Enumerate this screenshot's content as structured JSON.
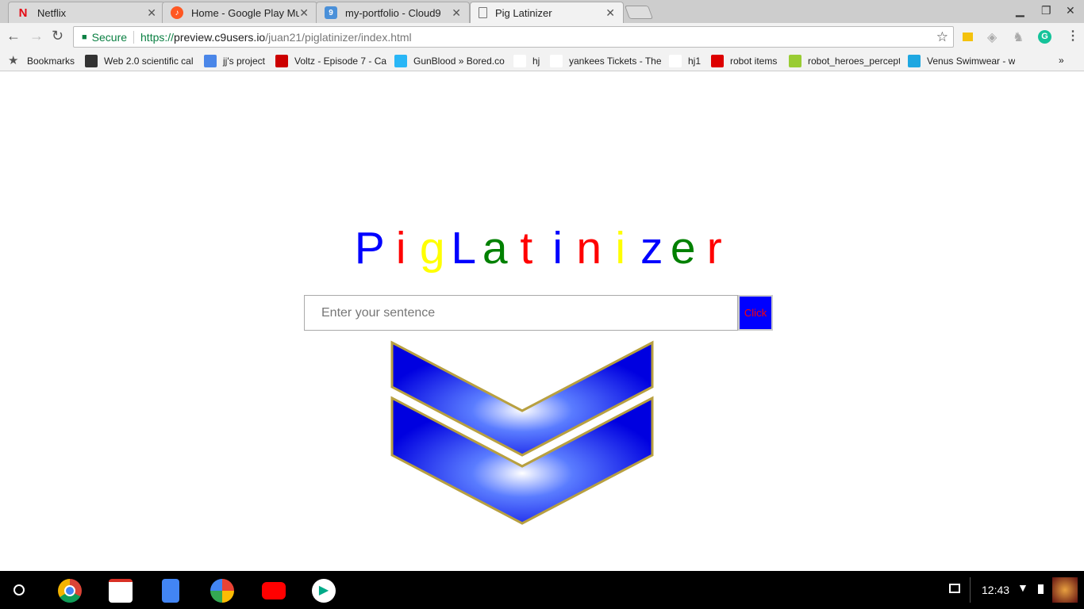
{
  "tabs": [
    {
      "title": "Netflix",
      "icon": "netflix-icon"
    },
    {
      "title": "Home - Google Play Mus",
      "icon": "play-music-icon"
    },
    {
      "title": "my-portfolio - Cloud9",
      "icon": "cloud9-icon"
    },
    {
      "title": "Pig Latinizer",
      "icon": "page-icon",
      "active": true
    }
  ],
  "address": {
    "secure_label": "Secure",
    "scheme": "https://",
    "host": "preview.c9users.io",
    "path": "/juan21/piglatinizer/index.html"
  },
  "bookmarks": [
    {
      "label": "Bookmarks",
      "color": "#555"
    },
    {
      "label": "Web 2.0 scientific cal",
      "color": "#333"
    },
    {
      "label": "jj's project",
      "color": "#4a86e8"
    },
    {
      "label": "Voltz - Episode 7 - Ca",
      "color": "#c00"
    },
    {
      "label": "GunBlood » Bored.co",
      "color": "#29b6f6"
    },
    {
      "label": "hj",
      "color": "#fff"
    },
    {
      "label": "yankees Tickets - The",
      "color": "#fff"
    },
    {
      "label": "hj1",
      "color": "#fff"
    },
    {
      "label": "robot items",
      "color": "#d00"
    },
    {
      "label": "robot_heroes_percept",
      "color": "#9c3"
    },
    {
      "label": "Venus Swimwear - w",
      "color": "#1ea7e1"
    }
  ],
  "page": {
    "title_letters": [
      {
        "ch": "P",
        "color": "#0000ff"
      },
      {
        "ch": "i",
        "color": "#ff0000"
      },
      {
        "ch": "g",
        "color": "#ffff00"
      },
      {
        "ch": "L",
        "color": "#0000ff"
      },
      {
        "ch": "a",
        "color": "#008000"
      },
      {
        "ch": "t",
        "color": "#ff0000"
      },
      {
        "ch": "i",
        "color": "#0000ff"
      },
      {
        "ch": "n",
        "color": "#ff0000"
      },
      {
        "ch": "i",
        "color": "#ffff00"
      },
      {
        "ch": "z",
        "color": "#0000ff"
      },
      {
        "ch": "e",
        "color": "#008000"
      },
      {
        "ch": "r",
        "color": "#ff0000"
      }
    ],
    "input_placeholder": "Enter your sentence",
    "button_label": "Click"
  },
  "taskbar": {
    "time": "12:43"
  }
}
